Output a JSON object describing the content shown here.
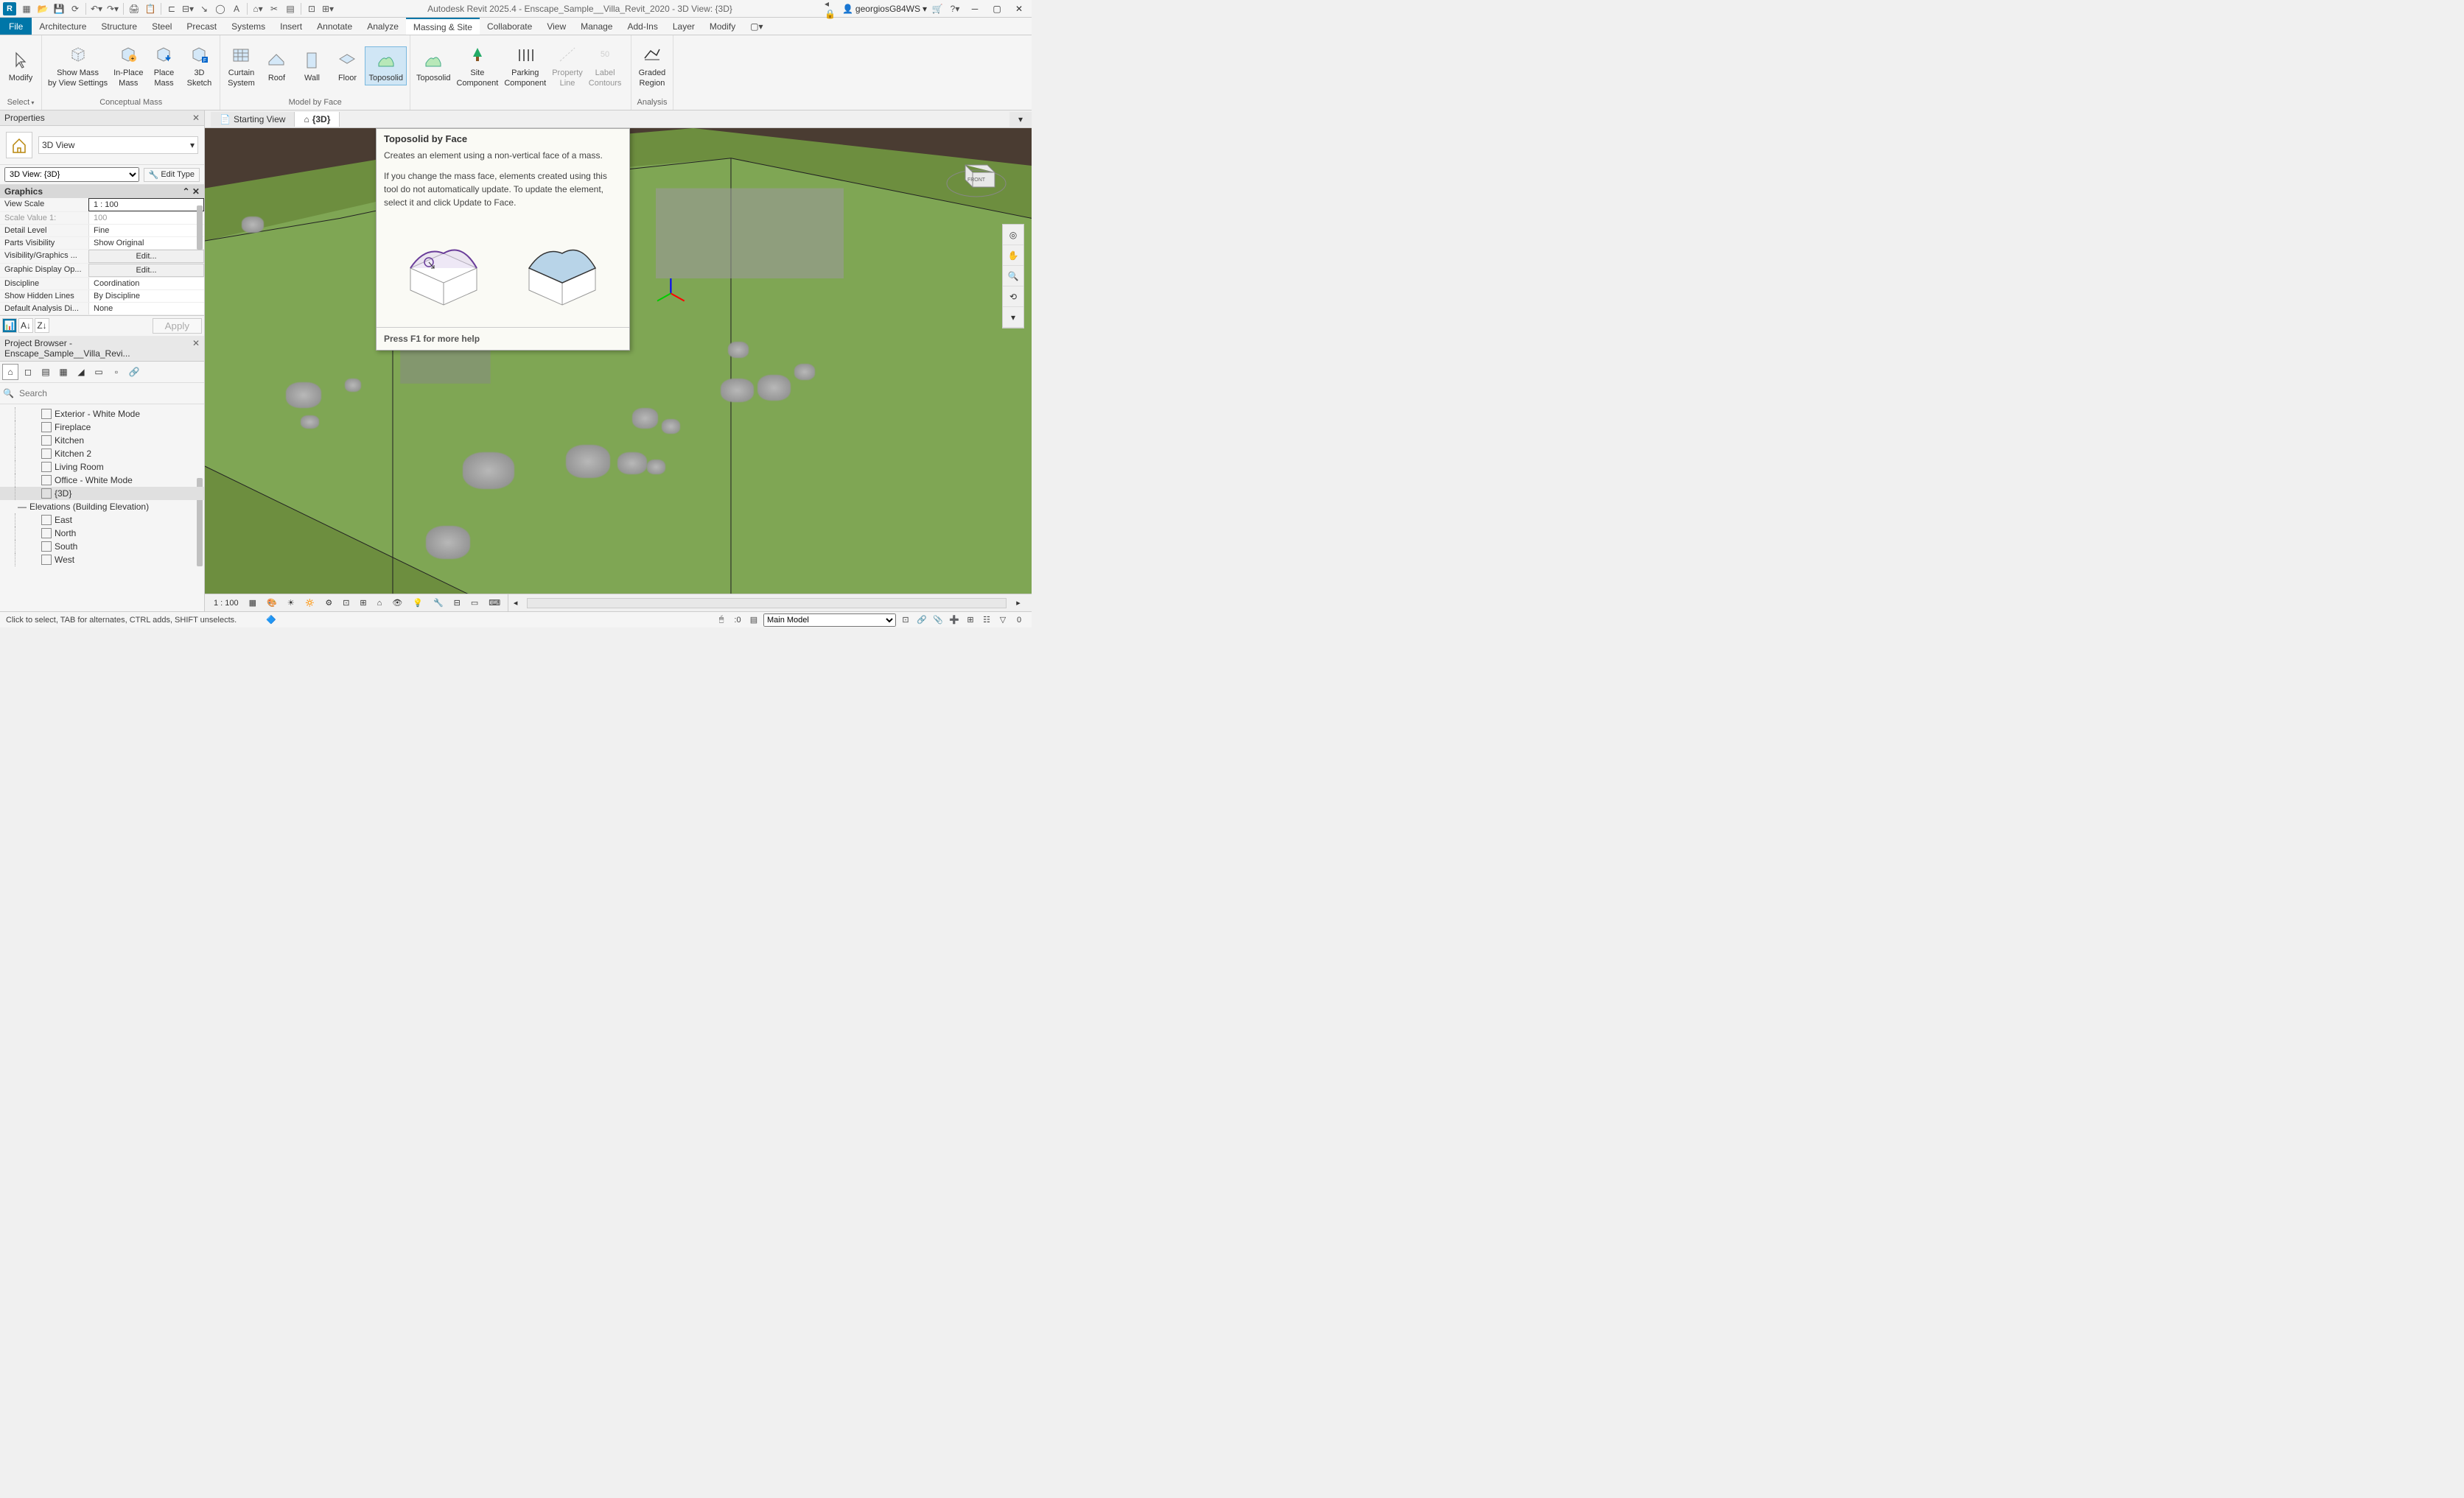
{
  "titlebar": {
    "app_letter": "R",
    "title": "Autodesk Revit 2025.4 - Enscape_Sample__Villa_Revit_2020 - 3D View: {3D}",
    "user": "georgiosG84WS"
  },
  "menu": {
    "file": "File",
    "tabs": [
      "Architecture",
      "Structure",
      "Steel",
      "Precast",
      "Systems",
      "Insert",
      "Annotate",
      "Analyze",
      "Massing & Site",
      "Collaborate",
      "View",
      "Manage",
      "Add-Ins",
      "Layer",
      "Modify"
    ],
    "active": "Massing & Site"
  },
  "ribbon": {
    "modify": {
      "label": "Modify",
      "group": "Select"
    },
    "groups": [
      {
        "label": "Conceptual Mass",
        "buttons": [
          {
            "text": "Show Mass\nby View Settings",
            "icon": "cube-dashed"
          },
          {
            "text": "In-Place\nMass",
            "icon": "cube-plus"
          },
          {
            "text": "Place\nMass",
            "icon": "cube-down"
          },
          {
            "text": "3D\nSketch",
            "icon": "cube-f"
          }
        ]
      },
      {
        "label": "Model by Face",
        "buttons": [
          {
            "text": "Curtain\nSystem",
            "icon": "grid-face"
          },
          {
            "text": "Roof",
            "icon": "roof-face"
          },
          {
            "text": "Wall",
            "icon": "wall-face"
          },
          {
            "text": "Floor",
            "icon": "floor-face"
          },
          {
            "text": "Toposolid",
            "icon": "topo-face",
            "highlighted": true
          }
        ]
      },
      {
        "label": "",
        "buttons": [
          {
            "text": "Toposolid",
            "icon": "topo"
          },
          {
            "text": "Site\nComponent",
            "icon": "tree"
          },
          {
            "text": "Parking\nComponent",
            "icon": "parking"
          },
          {
            "text": "Property\nLine",
            "icon": "prop-line",
            "disabled": true
          },
          {
            "text": "Label\nContours",
            "icon": "contour",
            "disabled": true
          }
        ]
      },
      {
        "label": "Analysis",
        "buttons": [
          {
            "text": "Graded\nRegion",
            "icon": "graded"
          }
        ]
      }
    ]
  },
  "properties": {
    "panel_title": "Properties",
    "type_name": "3D View",
    "instance": "3D View: {3D}",
    "edit_type": "Edit Type",
    "section": "Graphics",
    "rows": [
      {
        "k": "View Scale",
        "v": "1 : 100",
        "editable": true
      },
      {
        "k": "Scale Value    1:",
        "v": "100",
        "dimmed": true
      },
      {
        "k": "Detail Level",
        "v": "Fine"
      },
      {
        "k": "Parts Visibility",
        "v": "Show Original"
      },
      {
        "k": "Visibility/Graphics ...",
        "v": "Edit...",
        "btn": true
      },
      {
        "k": "Graphic Display Op...",
        "v": "Edit...",
        "btn": true
      },
      {
        "k": "Discipline",
        "v": "Coordination"
      },
      {
        "k": "Show Hidden Lines",
        "v": "By Discipline"
      },
      {
        "k": "Default Analysis Di...",
        "v": "None"
      }
    ],
    "apply": "Apply"
  },
  "browser": {
    "title": "Project Browser - Enscape_Sample__Villa_Revi...",
    "search_placeholder": "Search",
    "views": [
      "Exterior - White Mode",
      "Fireplace",
      "Kitchen",
      "Kitchen 2",
      "Living Room",
      "Office - White Mode",
      "{3D}"
    ],
    "selected": "{3D}",
    "elev_group": "Elevations (Building Elevation)",
    "elevs": [
      "East",
      "North",
      "South",
      "West"
    ]
  },
  "tabs": {
    "starting": "Starting View",
    "three_d": "{3D}"
  },
  "tooltip": {
    "title": "Toposolid by Face",
    "p1": "Creates an element using a non-vertical face of a mass.",
    "p2": "If you change the mass face, elements created using this tool do not automatically update. To update the element, select it and click Update to Face.",
    "footer": "Press F1 for more help"
  },
  "view_controls": {
    "scale": "1 : 100"
  },
  "statusbar": {
    "hint": "Click to select, TAB for alternates, CTRL adds, SHIFT unselects.",
    "model": "Main Model"
  }
}
